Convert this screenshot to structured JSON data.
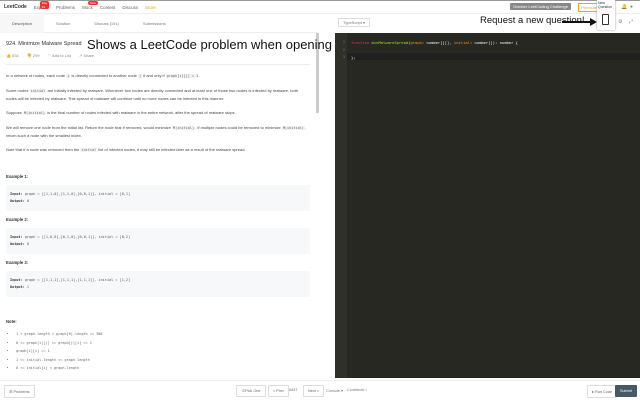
{
  "nav": {
    "logo": "LeetCode",
    "items": [
      {
        "label": "Explore",
        "badge": "Day 31"
      },
      {
        "label": "Problems"
      },
      {
        "label": "Mock",
        "badge": "New"
      },
      {
        "label": "Contest"
      },
      {
        "label": "Discuss"
      },
      {
        "label": "Store"
      }
    ],
    "challenge": "October LeetCoding Challenge",
    "premium": "Premium"
  },
  "tabs": [
    {
      "label": "Description"
    },
    {
      "label": "Solution"
    },
    {
      "label": "Discuss (191)"
    },
    {
      "label": "Submissions"
    }
  ],
  "problem": {
    "title": "924. Minimize Malware Spread",
    "likes": "534",
    "dislikes": "299",
    "add_to_list": "Add to List",
    "share": "Share",
    "p1a": "In a network of nodes, each node ",
    "p1b": "i",
    "p1c": " is directly connected to another node ",
    "p1d": "j",
    "p1e": " if and only if ",
    "p1f": "graph[i][j] = 1",
    "p1g": ".",
    "p2a": "Some nodes ",
    "p2b": "initial",
    "p2c": " are initially infected by malware.  Whenever two nodes are directly connected and at least one of those two nodes is infected by malware, both nodes will be infected by malware.  This spread of malware will continue until no more nodes can be infected in this manner.",
    "p3a": "Suppose ",
    "p3b": "M(initial)",
    "p3c": " is the final number of nodes infected with malware in the entire network, after the spread of malware stops.",
    "p4a": "We will remove one node from the initial list.  Return the node that if removed, would minimize ",
    "p4b": "M(initial)",
    "p4c": ".  If multiple nodes could be removed to minimize ",
    "p4d": "M(initial)",
    "p4e": ", return such a node with the smallest index.",
    "p5a": "Note that if a node was removed from the ",
    "p5b": "initial",
    "p5c": " list of infected nodes, it may still be infected later as a result of the malware spread.",
    "examples": [
      {
        "label": "Example 1:",
        "input": "graph = [[1,1,0],[1,1,0],[0,0,1]], initial = [0,1]",
        "output": "0"
      },
      {
        "label": "Example 2:",
        "input": "graph = [[1,0,0],[0,1,0],[0,0,1]], initial = [0,2]",
        "output": "0"
      },
      {
        "label": "Example 3:",
        "input": "graph = [[1,1,1],[1,1,1],[1,1,1]], initial = [1,2]",
        "output": "1"
      }
    ],
    "input_label": "Input:",
    "output_label": "Output:",
    "note_label": "Note:",
    "notes": [
      "1 < graph.length = graph[0].length <= 300",
      "0 <= graph[i][j] == graph[j][i] <= 1",
      "graph[i][i] == 1",
      "1 <= initial.length <= graph.length",
      "0 <= initial[i] < graph.length"
    ]
  },
  "editor": {
    "language": "TypeScript",
    "line_numbers": [
      "1",
      "2",
      "3"
    ],
    "kw": "function",
    "fn": "minMalwareSpread",
    "p1": "graph",
    "t1": ": number[][], ",
    "p2": "initial",
    "t2": ": number[]): number {",
    "close": "};"
  },
  "annotations": {
    "left": "Shows a LeetCode problem when opening a new tab!",
    "right": "Request a new question!",
    "popup": "New Question"
  },
  "bottom": {
    "problems": "Problems",
    "pick_one": "Pick One",
    "prev": "< Prev",
    "index": "#437",
    "next": "Next >",
    "console": "Console",
    "contribute": "Contribute i",
    "run": "Run Code",
    "submit": "Submit"
  }
}
